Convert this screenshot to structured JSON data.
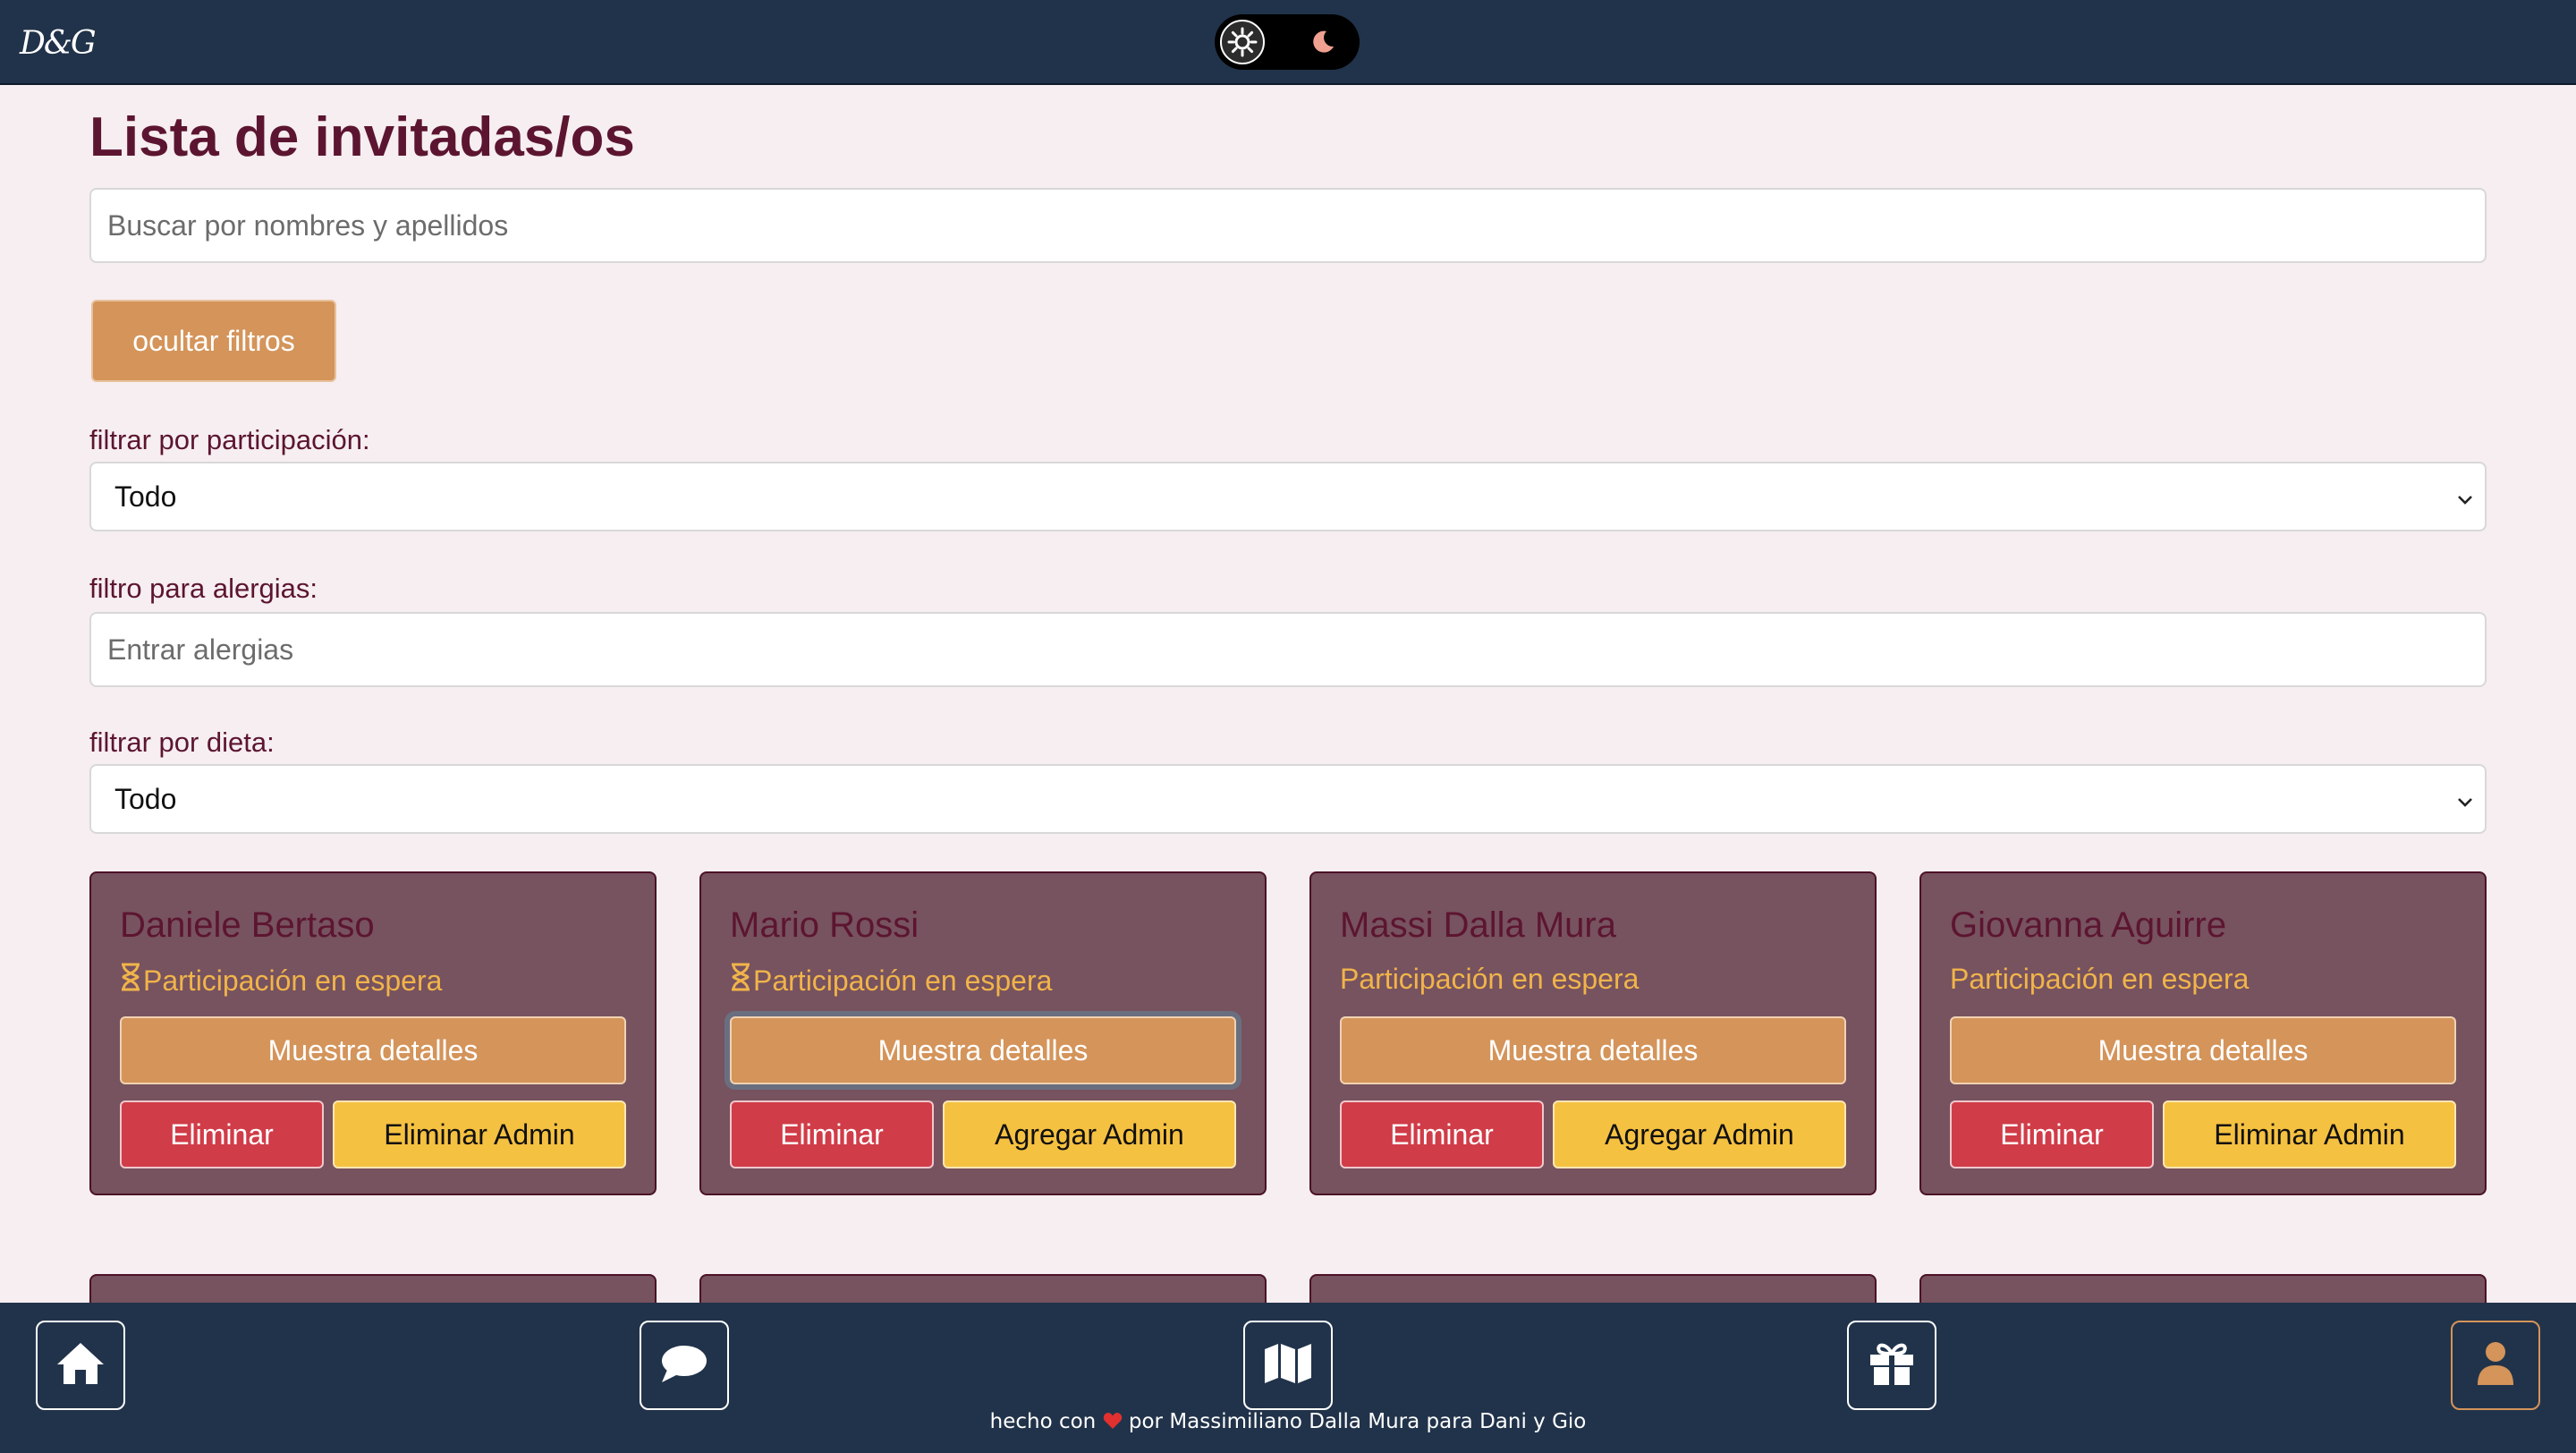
{
  "header": {
    "logo_text": "D&G",
    "theme_toggle": {
      "sun_icon": "sun-icon",
      "moon_icon": "moon-icon",
      "moon_color": "#f0a090"
    }
  },
  "main": {
    "title": "Lista de invitadas/os",
    "search_placeholder": "Buscar por nombres y apellidos",
    "toggle_filters_label": "ocultar filtros",
    "filters": {
      "participation_label": "filtrar por participación:",
      "participation_value": "Todo",
      "allergy_label": "filtro para alergias:",
      "allergy_placeholder": "Entrar alergias",
      "diet_label": "filtrar por dieta:",
      "diet_value": "Todo"
    },
    "guests": [
      {
        "name": "Daniele Bertaso",
        "status": "Participación en espera",
        "show_hourglass": true,
        "details_label": "Muestra detalles",
        "delete_label": "Eliminar",
        "admin_label": "Eliminar Admin"
      },
      {
        "name": "Mario Rossi",
        "status": "Participación en espera",
        "show_hourglass": true,
        "details_label": "Muestra detalles",
        "delete_label": "Eliminar",
        "admin_label": "Agregar Admin"
      },
      {
        "name": "Massi Dalla Mura",
        "status": "Participación en espera",
        "show_hourglass": false,
        "details_label": "Muestra detalles",
        "delete_label": "Eliminar",
        "admin_label": "Agregar Admin"
      },
      {
        "name": "Giovanna Aguirre",
        "status": "Participación en espera",
        "show_hourglass": false,
        "details_label": "Muestra detalles",
        "delete_label": "Eliminar",
        "admin_label": "Eliminar Admin"
      }
    ]
  },
  "bottom_nav": {
    "items": [
      {
        "icon": "home-icon"
      },
      {
        "icon": "chat-icon"
      },
      {
        "icon": "map-icon"
      },
      {
        "icon": "gift-icon"
      },
      {
        "icon": "user-icon"
      }
    ],
    "footer_prefix": "hecho con",
    "footer_suffix": "por Massimiliano Dalla Mura para Dani y Gio"
  },
  "colors": {
    "nav_bg": "#21334a",
    "page_bg": "#f6eef0",
    "title": "#5c1530",
    "card_bg": "#77525f",
    "status": "#f0b44a",
    "details_button": "#d4945a",
    "delete_button": "#d03c48",
    "admin_button": "#f5c141"
  }
}
